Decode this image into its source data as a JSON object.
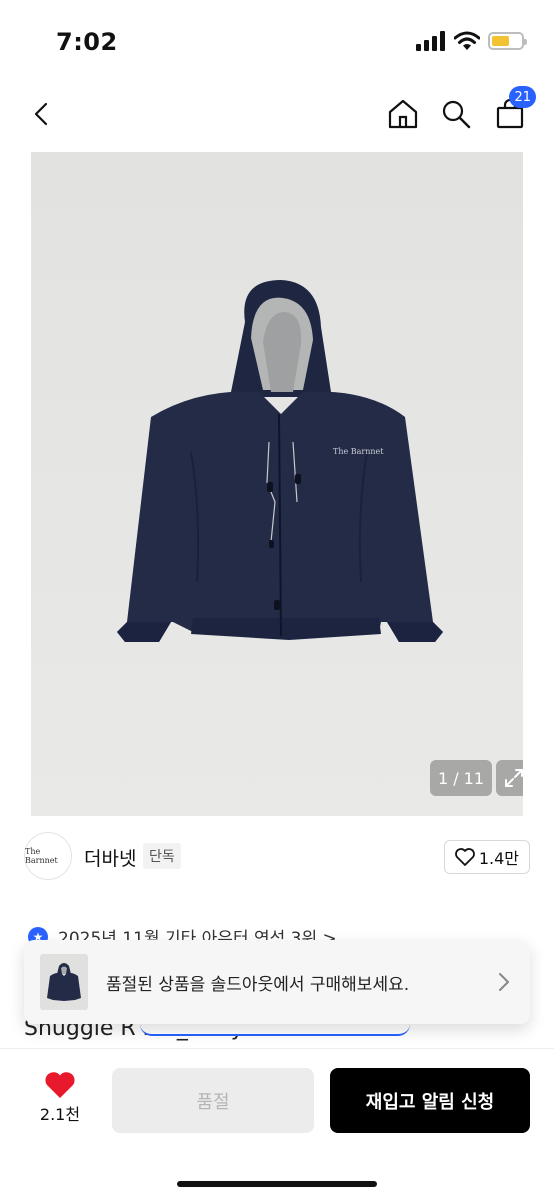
{
  "status_bar": {
    "time": "7:02",
    "battery_color": "#f2c230"
  },
  "nav": {
    "cart_count": "21",
    "badge_color": "#2962ff"
  },
  "gallery": {
    "counter": "1 / 11",
    "jacket_logo": "The Barnnet"
  },
  "brand": {
    "logo_text": "The Barnnet",
    "name": "더바넷",
    "badge": "단독",
    "likes": "1.4만"
  },
  "promo": {
    "text": "2025년 11월 기타 아우터 연석 3위 >"
  },
  "product": {
    "title_peek": "Snuggle R                                ket_Navy"
  },
  "banner": {
    "text": "품절된 상품을 솔드아웃에서 구매해보세요."
  },
  "bottom": {
    "wish_count": "2.1천",
    "soldout_label": "품절",
    "restock_label": "재입고 알림 신청",
    "heart_color": "#e8192c"
  }
}
